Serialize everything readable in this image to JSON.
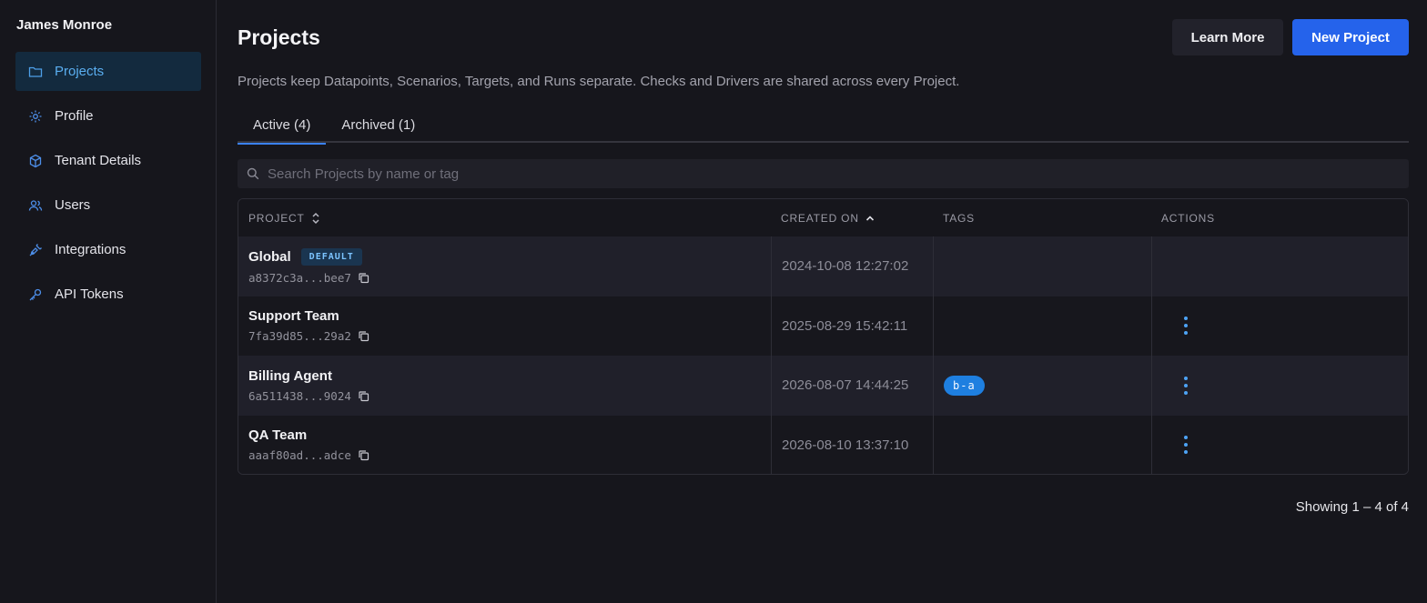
{
  "sidebar": {
    "user_name": "James Monroe",
    "items": [
      {
        "label": "Projects",
        "icon": "folder-icon",
        "active": true
      },
      {
        "label": "Profile",
        "icon": "gear-icon"
      },
      {
        "label": "Tenant Details",
        "icon": "cube-icon"
      },
      {
        "label": "Users",
        "icon": "users-icon"
      },
      {
        "label": "Integrations",
        "icon": "plug-icon"
      },
      {
        "label": "API Tokens",
        "icon": "key-icon"
      }
    ]
  },
  "header": {
    "title": "Projects",
    "learn_more_label": "Learn More",
    "new_project_label": "New Project",
    "description": "Projects keep Datapoints, Scenarios, Targets, and Runs separate. Checks and Drivers are shared across every Project."
  },
  "tabs": [
    {
      "label": "Active (4)",
      "active": true
    },
    {
      "label": "Archived (1)",
      "active": false
    }
  ],
  "search": {
    "placeholder": "Search Projects by name or tag",
    "value": ""
  },
  "table": {
    "headers": {
      "project": "PROJECT",
      "created_on": "CREATED ON",
      "tags": "TAGS",
      "actions": "ACTIONS"
    },
    "rows": [
      {
        "name": "Global",
        "badge": "DEFAULT",
        "id": "a8372c3a...bee7",
        "created": "2024-10-08 12:27:02",
        "tag": "",
        "has_actions": false
      },
      {
        "name": "Support Team",
        "badge": "",
        "id": "7fa39d85...29a2",
        "created": "2025-08-29 15:42:11",
        "tag": "",
        "has_actions": true
      },
      {
        "name": "Billing Agent",
        "badge": "",
        "id": "6a511438...9024",
        "created": "2026-08-07 14:44:25",
        "tag": "b-a",
        "has_actions": true
      },
      {
        "name": "QA Team",
        "badge": "",
        "id": "aaaf80ad...adce",
        "created": "2026-08-10 13:37:10",
        "tag": "",
        "has_actions": true
      }
    ]
  },
  "footer": {
    "showing": "Showing 1 – 4 of 4"
  },
  "colors": {
    "accent": "#2563eb",
    "active_nav_bg": "#132a3e",
    "active_nav_text": "#5aaef0",
    "tag_bg": "#1e7fe0",
    "kebab": "#4da3f5"
  }
}
